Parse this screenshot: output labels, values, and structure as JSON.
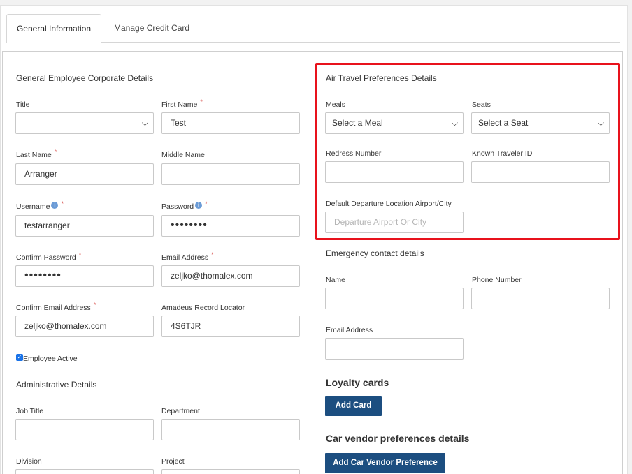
{
  "tabs": [
    {
      "label": "General Information"
    },
    {
      "label": "Manage Credit Card"
    }
  ],
  "left": {
    "section_title": "General Employee Corporate Details",
    "title_label": "Title",
    "title_value": "",
    "first_name_label": "First Name",
    "first_name_value": "Test",
    "last_name_label": "Last Name",
    "last_name_value": "Arranger",
    "middle_name_label": "Middle Name",
    "middle_name_value": "",
    "username_label": "Username",
    "username_value": "testarranger",
    "password_label": "Password",
    "password_value": "••••••••",
    "confirm_password_label": "Confirm Password",
    "confirm_password_value": "••••••••",
    "email_label": "Email Address",
    "email_value": "zeljko@thomalex.com",
    "confirm_email_label": "Confirm Email Address",
    "confirm_email_value": "zeljko@thomalex.com",
    "amadeus_label": "Amadeus Record Locator",
    "amadeus_value": "4S6TJR",
    "employee_active_label": "Employee Active",
    "admin_title": "Administrative Details",
    "job_title_label": "Job Title",
    "department_label": "Department",
    "division_label": "Division",
    "project_label": "Project",
    "required_mark": "*",
    "info_mark": "i"
  },
  "air": {
    "section_title": "Air Travel Preferences Details",
    "meals_label": "Meals",
    "meals_value": "Select a Meal",
    "seats_label": "Seats",
    "seats_value": "Select a Seat",
    "redress_label": "Redress Number",
    "known_traveler_label": "Known Traveler ID",
    "departure_label": "Default Departure Location Airport/City",
    "departure_placeholder": "Departure Airport Or City"
  },
  "emergency": {
    "section_title": "Emergency contact details",
    "name_label": "Name",
    "phone_label": "Phone Number",
    "email_label": "Email Address"
  },
  "loyalty": {
    "title": "Loyalty cards",
    "add_button": "Add Card"
  },
  "car": {
    "title": "Car vendor preferences details",
    "add_button": "Add Car Vendor Preference"
  },
  "icons": {
    "chevron": "chevron-down-icon",
    "info": "info-icon",
    "check": "checkmark-icon"
  },
  "colors": {
    "highlight": "#e8121c",
    "button": "#1c4e80",
    "required": "#d9534f",
    "info": "#6b9bd6"
  }
}
